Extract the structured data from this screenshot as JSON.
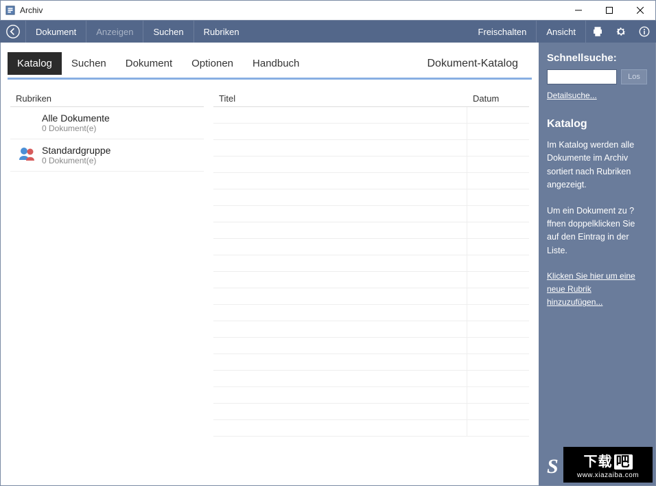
{
  "window": {
    "title": "Archiv"
  },
  "toolbar": {
    "items": [
      "Dokument",
      "Anzeigen",
      "Suchen",
      "Rubriken"
    ],
    "right_items": [
      "Freischalten",
      "Ansicht"
    ]
  },
  "tabs": {
    "items": [
      "Katalog",
      "Suchen",
      "Dokument",
      "Optionen",
      "Handbuch"
    ],
    "active_index": 0,
    "page_title": "Dokument-Katalog"
  },
  "columns": {
    "rubriken_header": "Rubriken",
    "titel_header": "Titel",
    "datum_header": "Datum"
  },
  "rubriken": [
    {
      "name": "Alle Dokumente",
      "count": "0 Dokument(e)",
      "icon": "none"
    },
    {
      "name": "Standardgruppe",
      "count": "0 Dokument(e)",
      "icon": "group"
    }
  ],
  "sidebar": {
    "quicksearch_title": "Schnellsuche:",
    "search_value": "",
    "go_label": "Los",
    "detail_link": "Detailsuche...",
    "section_title": "Katalog",
    "para1": "Im Katalog werden alle Dokumente im Archiv sortiert nach Rubriken angezeigt.",
    "para2": "Um ein Dokument zu ?ffnen doppelklicken Sie auf den Eintrag in der Liste.",
    "add_link": "Klicken Sie hier um eine neue Rubrik hinzuzufügen..."
  },
  "watermark": {
    "top_left": "下载",
    "top_right": "吧",
    "bottom": "www.xiazaiba.com"
  },
  "decor": {
    "s": "S"
  }
}
